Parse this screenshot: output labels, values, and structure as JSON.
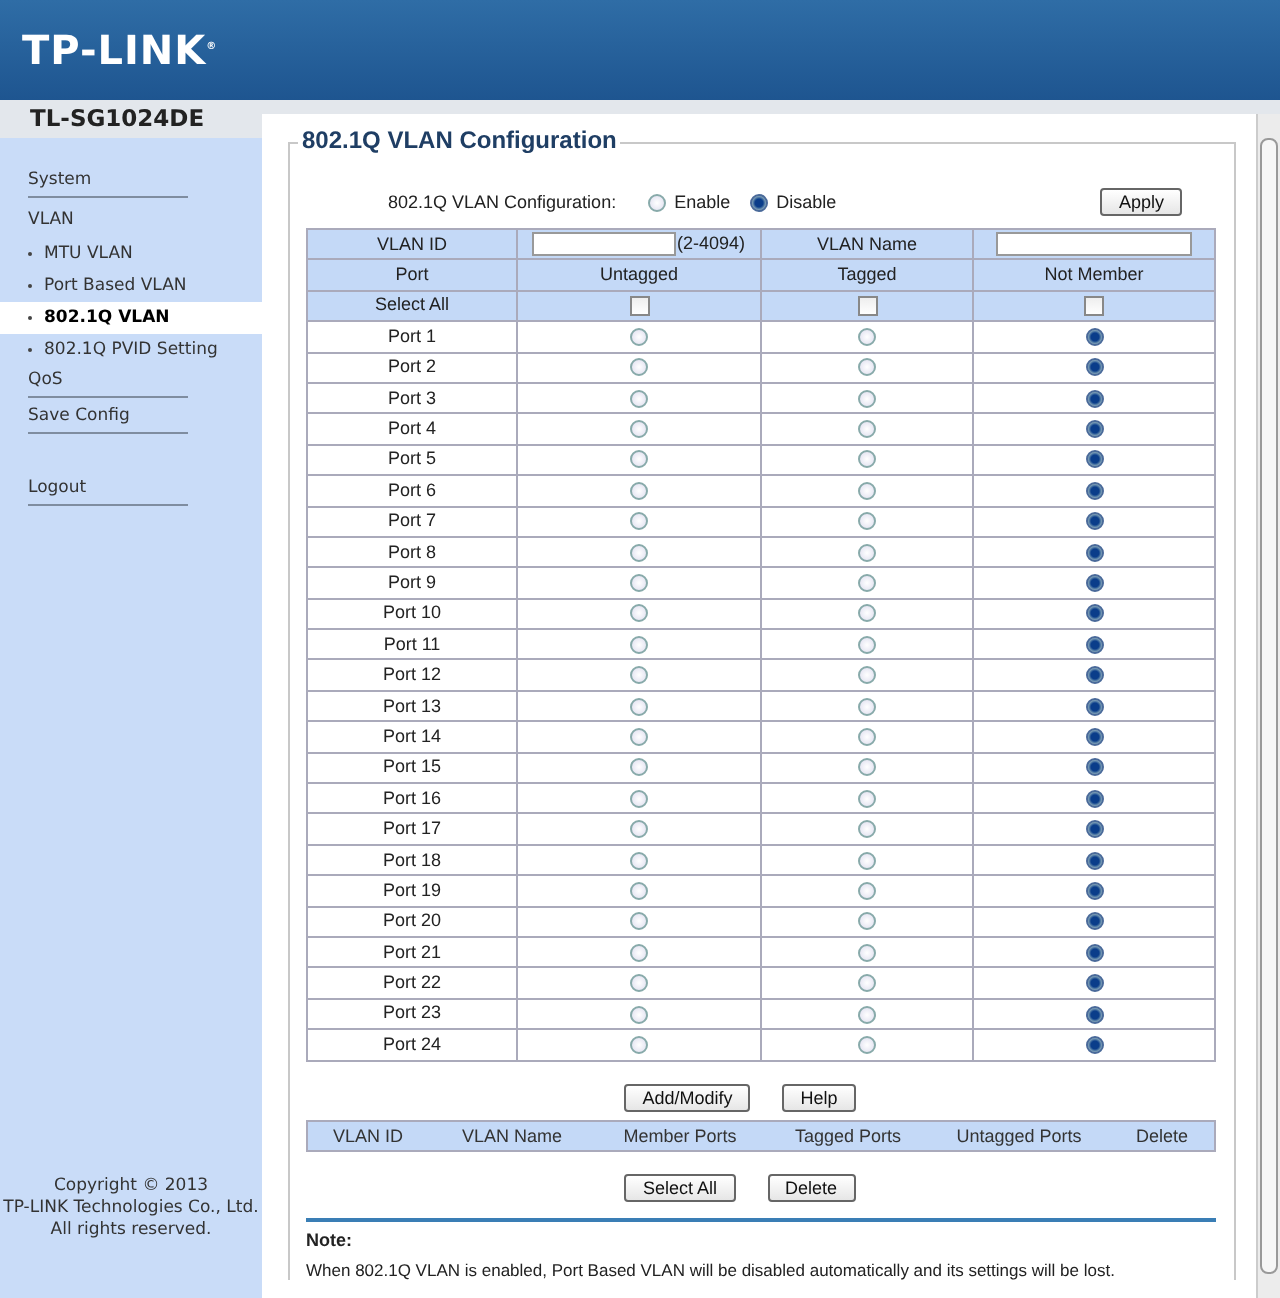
{
  "header": {
    "logo": "TP-LINK",
    "logo_mark": "®"
  },
  "model": "TL-SG1024DE",
  "sidebar": {
    "items": [
      {
        "label": "System",
        "kind": "section",
        "selected": false,
        "divider": true
      },
      {
        "label": "VLAN",
        "kind": "section",
        "selected": false,
        "divider": false
      },
      {
        "label": "MTU VLAN",
        "kind": "sub",
        "selected": false,
        "divider": false
      },
      {
        "label": "Port Based VLAN",
        "kind": "sub",
        "selected": false,
        "divider": false
      },
      {
        "label": "802.1Q VLAN",
        "kind": "sub",
        "selected": true,
        "divider": false
      },
      {
        "label": "802.1Q PVID Setting",
        "kind": "sub",
        "selected": false,
        "divider": false
      },
      {
        "label": "QoS",
        "kind": "section",
        "selected": false,
        "divider": true
      },
      {
        "label": "Save Config",
        "kind": "section",
        "selected": false,
        "divider": true
      }
    ],
    "logout": "Logout",
    "copyright": [
      "Copyright © 2013",
      "TP-LINK Technologies Co., Ltd.",
      "All rights reserved."
    ]
  },
  "panel": {
    "title": "802.1Q VLAN Configuration",
    "mode": {
      "label": "802.1Q VLAN Configuration:",
      "options": [
        {
          "label": "Enable",
          "selected": false
        },
        {
          "label": "Disable",
          "selected": true
        }
      ]
    },
    "apply": "Apply",
    "table": {
      "vlan_id_label": "VLAN ID",
      "vlan_id_hint": "(2-4094)",
      "vlan_name_label": "VLAN Name",
      "columns": [
        "Port",
        "Untagged",
        "Tagged",
        "Not Member"
      ],
      "select_all": {
        "label": "Select All",
        "checks": [
          false,
          false,
          false
        ]
      },
      "ports": [
        {
          "name": "Port 1",
          "untagged": false,
          "tagged": false,
          "not_member": true
        },
        {
          "name": "Port 2",
          "untagged": false,
          "tagged": false,
          "not_member": true
        },
        {
          "name": "Port 3",
          "untagged": false,
          "tagged": false,
          "not_member": true
        },
        {
          "name": "Port 4",
          "untagged": false,
          "tagged": false,
          "not_member": true
        },
        {
          "name": "Port 5",
          "untagged": false,
          "tagged": false,
          "not_member": true
        },
        {
          "name": "Port 6",
          "untagged": false,
          "tagged": false,
          "not_member": true
        },
        {
          "name": "Port 7",
          "untagged": false,
          "tagged": false,
          "not_member": true
        },
        {
          "name": "Port 8",
          "untagged": false,
          "tagged": false,
          "not_member": true
        },
        {
          "name": "Port 9",
          "untagged": false,
          "tagged": false,
          "not_member": true
        },
        {
          "name": "Port 10",
          "untagged": false,
          "tagged": false,
          "not_member": true
        },
        {
          "name": "Port 11",
          "untagged": false,
          "tagged": false,
          "not_member": true
        },
        {
          "name": "Port 12",
          "untagged": false,
          "tagged": false,
          "not_member": true
        },
        {
          "name": "Port 13",
          "untagged": false,
          "tagged": false,
          "not_member": true
        },
        {
          "name": "Port 14",
          "untagged": false,
          "tagged": false,
          "not_member": true
        },
        {
          "name": "Port 15",
          "untagged": false,
          "tagged": false,
          "not_member": true
        },
        {
          "name": "Port 16",
          "untagged": false,
          "tagged": false,
          "not_member": true
        },
        {
          "name": "Port 17",
          "untagged": false,
          "tagged": false,
          "not_member": true
        },
        {
          "name": "Port 18",
          "untagged": false,
          "tagged": false,
          "not_member": true
        },
        {
          "name": "Port 19",
          "untagged": false,
          "tagged": false,
          "not_member": true
        },
        {
          "name": "Port 20",
          "untagged": false,
          "tagged": false,
          "not_member": true
        },
        {
          "name": "Port 21",
          "untagged": false,
          "tagged": false,
          "not_member": true
        },
        {
          "name": "Port 22",
          "untagged": false,
          "tagged": false,
          "not_member": true
        },
        {
          "name": "Port 23",
          "untagged": false,
          "tagged": false,
          "not_member": true
        },
        {
          "name": "Port 24",
          "untagged": false,
          "tagged": false,
          "not_member": true
        }
      ]
    },
    "buttons": [
      "Add/Modify",
      "Help"
    ],
    "list_columns": [
      "VLAN ID",
      "VLAN Name",
      "Member Ports",
      "Tagged Ports",
      "Untagged Ports",
      "Delete"
    ],
    "list_buttons": [
      "Select All",
      "Delete"
    ],
    "note_title": "Note:",
    "note": "When 802.1Q VLAN is enabled, Port Based VLAN will be disabled automatically and its settings will be lost."
  }
}
